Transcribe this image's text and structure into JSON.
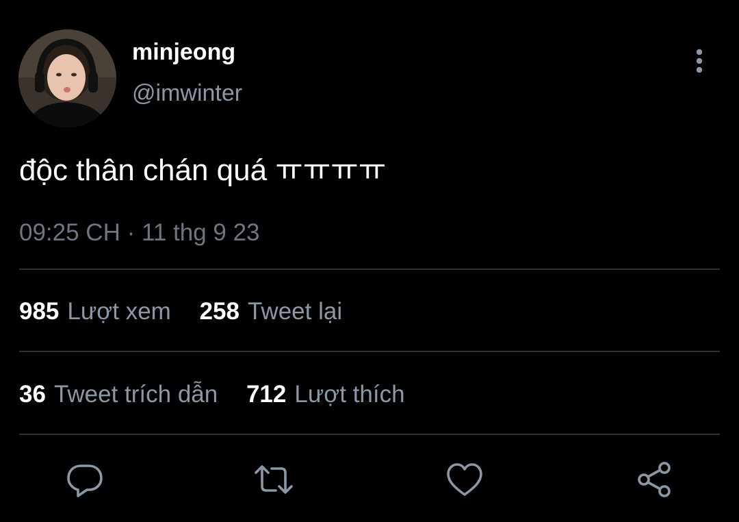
{
  "author": {
    "display_name": "minjeong",
    "handle": "@imwinter"
  },
  "tweet": {
    "text": "độc thân chán quá ㅠㅠㅠㅠ",
    "timestamp": "09:25 CH · 11 thg 9 23"
  },
  "stats": {
    "views": {
      "count": "985",
      "label": "Lượt xem"
    },
    "retweets": {
      "count": "258",
      "label": "Tweet lại"
    },
    "quotes": {
      "count": "36",
      "label": "Tweet trích dẫn"
    },
    "likes": {
      "count": "712",
      "label": "Lượt thích"
    }
  },
  "actions": [
    "reply-icon",
    "retweet-icon",
    "like-icon",
    "share-icon"
  ],
  "colors": {
    "background": "#000000",
    "primary_text": "#ffffff",
    "secondary_text": "#8b98a5",
    "divider": "#2f3336",
    "icon": "#8b98a5"
  }
}
